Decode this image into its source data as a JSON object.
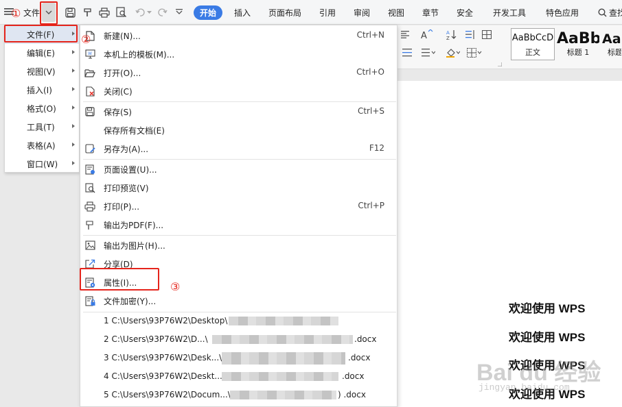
{
  "toolbar": {
    "menu_label": "文件",
    "tabs": [
      "开始",
      "插入",
      "页面布局",
      "引用",
      "审阅",
      "视图",
      "章节",
      "安全",
      "开发工具",
      "特色应用"
    ],
    "search_label": "查找"
  },
  "ribbon": {
    "styles": [
      {
        "sample": "AaBbCcD",
        "label": "正文"
      },
      {
        "sample": "AaBb",
        "label": "标题 1"
      },
      {
        "sample": "AaI",
        "label": "标题"
      }
    ]
  },
  "left_menu": {
    "items": [
      "文件(F)",
      "编辑(E)",
      "视图(V)",
      "插入(I)",
      "格式(O)",
      "工具(T)",
      "表格(A)",
      "窗口(W)"
    ]
  },
  "submenu": {
    "items": [
      {
        "label": "新建(N)...",
        "shortcut": "Ctrl+N",
        "icon": "new-doc-icon"
      },
      {
        "label": "本机上的模板(M)...",
        "shortcut": "",
        "icon": "template-icon"
      },
      {
        "label": "打开(O)...",
        "shortcut": "Ctrl+O",
        "icon": "open-folder-icon"
      },
      {
        "label": "关闭(C)",
        "shortcut": "",
        "icon": "close-doc-icon"
      },
      {
        "label": "保存(S)",
        "shortcut": "Ctrl+S",
        "icon": "save-icon"
      },
      {
        "label": "保存所有文档(E)",
        "shortcut": "",
        "icon": ""
      },
      {
        "label": "另存为(A)...",
        "shortcut": "F12",
        "icon": "save-as-icon"
      },
      {
        "label": "页面设置(U)...",
        "shortcut": "",
        "icon": "page-setup-icon"
      },
      {
        "label": "打印预览(V)",
        "shortcut": "",
        "icon": "print-preview-icon"
      },
      {
        "label": "打印(P)...",
        "shortcut": "Ctrl+P",
        "icon": "print-icon"
      },
      {
        "label": "输出为PDF(F)...",
        "shortcut": "",
        "icon": "pdf-export-icon"
      },
      {
        "label": "输出为图片(H)...",
        "shortcut": "",
        "icon": "image-export-icon"
      },
      {
        "label": "分享(D)",
        "shortcut": "",
        "icon": "share-icon"
      },
      {
        "label": "属性(I)...",
        "shortcut": "",
        "icon": "properties-icon"
      },
      {
        "label": "文件加密(Y)...",
        "shortcut": "",
        "icon": "encrypt-icon"
      }
    ],
    "recent": [
      {
        "path": "1 C:\\Users\\93P76W2\\Desktop\\",
        "ext": ""
      },
      {
        "path": "2 C:\\Users\\93P76W2\\D...\\",
        "ext": ".docx"
      },
      {
        "path": "3 C:\\Users\\93P76W2\\Desk...\\",
        "ext": ".docx"
      },
      {
        "path": "4 C:\\Users\\93P76W2\\Deskt...\\",
        "ext": ".docx"
      },
      {
        "path": "5 C:\\Users\\93P76W2\\Docum...\\",
        "ext": ") .docx"
      }
    ]
  },
  "document": {
    "lines": [
      "欢迎使用 WPS",
      "欢迎使用 WPS",
      "欢迎使用 WPS",
      "欢迎使用 WPS"
    ],
    "watermark": "Bai du 经验",
    "watermark_sub": "jingyan.baidu.com"
  },
  "annotations": {
    "step1": "①",
    "step2": "②",
    "step3": "③"
  },
  "colors": {
    "accent": "#3a7be5",
    "annotation": "#e5241b"
  }
}
